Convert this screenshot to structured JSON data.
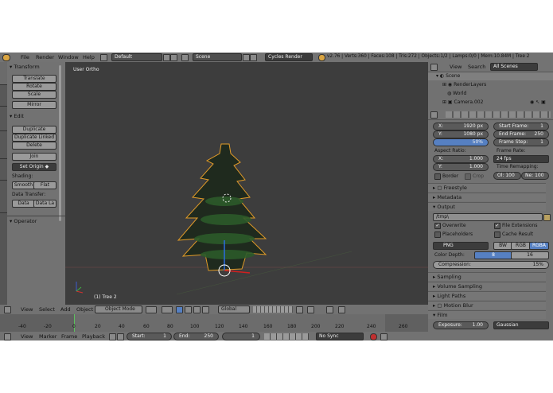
{
  "topbar": {
    "menus": [
      "File",
      "Render",
      "Window",
      "Help"
    ],
    "layout": "Default",
    "scene": "Scene",
    "engine": "Cycles Render",
    "stats": "v2.76 | Verts:360 | Faces:108 | Tris:272 | Objects:1/2 | Lamps:0/0 | Mem:10.84M | Tree 2"
  },
  "toolshelf": {
    "tabs": [
      "Tools",
      "Create",
      "Relations",
      "Animation",
      "Physics",
      "Grease Pencil"
    ],
    "transform_title": "Transform",
    "translate": "Translate",
    "rotate": "Rotate",
    "scale": "Scale",
    "mirror": "Mirror",
    "edit_title": "Edit",
    "duplicate": "Duplicate",
    "duplicate_linked": "Duplicate Linked",
    "delete": "Delete",
    "join": "Join",
    "set_origin": "Set Origin",
    "shading_label": "Shading:",
    "smooth": "Smooth",
    "flat": "Flat",
    "data_transfer_label": "Data Transfer:",
    "data": "Data",
    "data_layers": "Data La",
    "operator_title": "Operator"
  },
  "viewport": {
    "view_name": "User Ortho",
    "object_label": "(1) Tree 2"
  },
  "viewheader": {
    "menus": [
      "View",
      "Select",
      "Add",
      "Object"
    ],
    "mode": "Object Mode",
    "orientation": "Global"
  },
  "timeline": {
    "ruler": [
      "-40",
      "-20",
      "0",
      "20",
      "40",
      "60",
      "80",
      "100",
      "120",
      "140",
      "160",
      "180",
      "200",
      "220",
      "240",
      "260"
    ],
    "menus": [
      "View",
      "Marker",
      "Frame",
      "Playback"
    ],
    "start_label": "Start:",
    "start": "1",
    "end_label": "End:",
    "end": "250",
    "current": "1",
    "sync": "No Sync"
  },
  "outliner": {
    "menus": [
      "View",
      "Search"
    ],
    "filter": "All Scenes",
    "items": [
      "Scene",
      "RenderLayers",
      "World",
      "Camera.002"
    ]
  },
  "properties": {
    "resolution_x": "1920 px",
    "resolution_y": "1080 px",
    "resolution_pct": "50%",
    "x_label": "X:",
    "y_label": "Y:",
    "frame_range_label": "Frame Range:",
    "start_frame_label": "Start Frame:",
    "start_frame": "1",
    "end_frame_label": "End Frame:",
    "end_frame": "250",
    "frame_step_label": "Frame Step:",
    "frame_step": "1",
    "aspect_label": "Aspect Ratio:",
    "aspect_x": "1.000",
    "aspect_y": "1.000",
    "frame_rate_label": "Frame Rate:",
    "frame_rate": "24 fps",
    "time_remap_label": "Time Remapping:",
    "time_old": "Ol: 100",
    "time_new": "Ne: 100",
    "border": "Border",
    "crop": "Crop",
    "freestyle": "Freestyle",
    "metadata": "Metadata",
    "output": "Output",
    "output_path": "/tmp\\",
    "overwrite": "Overwrite",
    "file_extensions": "File Extensions",
    "placeholders": "Placeholders",
    "cache_result": "Cache Result",
    "format": "PNG",
    "bw": "BW",
    "rgb": "RGB",
    "rgba": "RGBA",
    "color_depth_label": "Color Depth:",
    "depth_8": "8",
    "depth_16": "16",
    "compression": "Compression:",
    "compression_value": "15%",
    "sampling": "Sampling",
    "volume_sampling": "Volume Sampling",
    "light_paths": "Light Paths",
    "motion_blur": "Motion Blur",
    "film": "Film",
    "exposure_label": "Exposure:",
    "exposure": "1.00",
    "filter": "Gaussian"
  }
}
